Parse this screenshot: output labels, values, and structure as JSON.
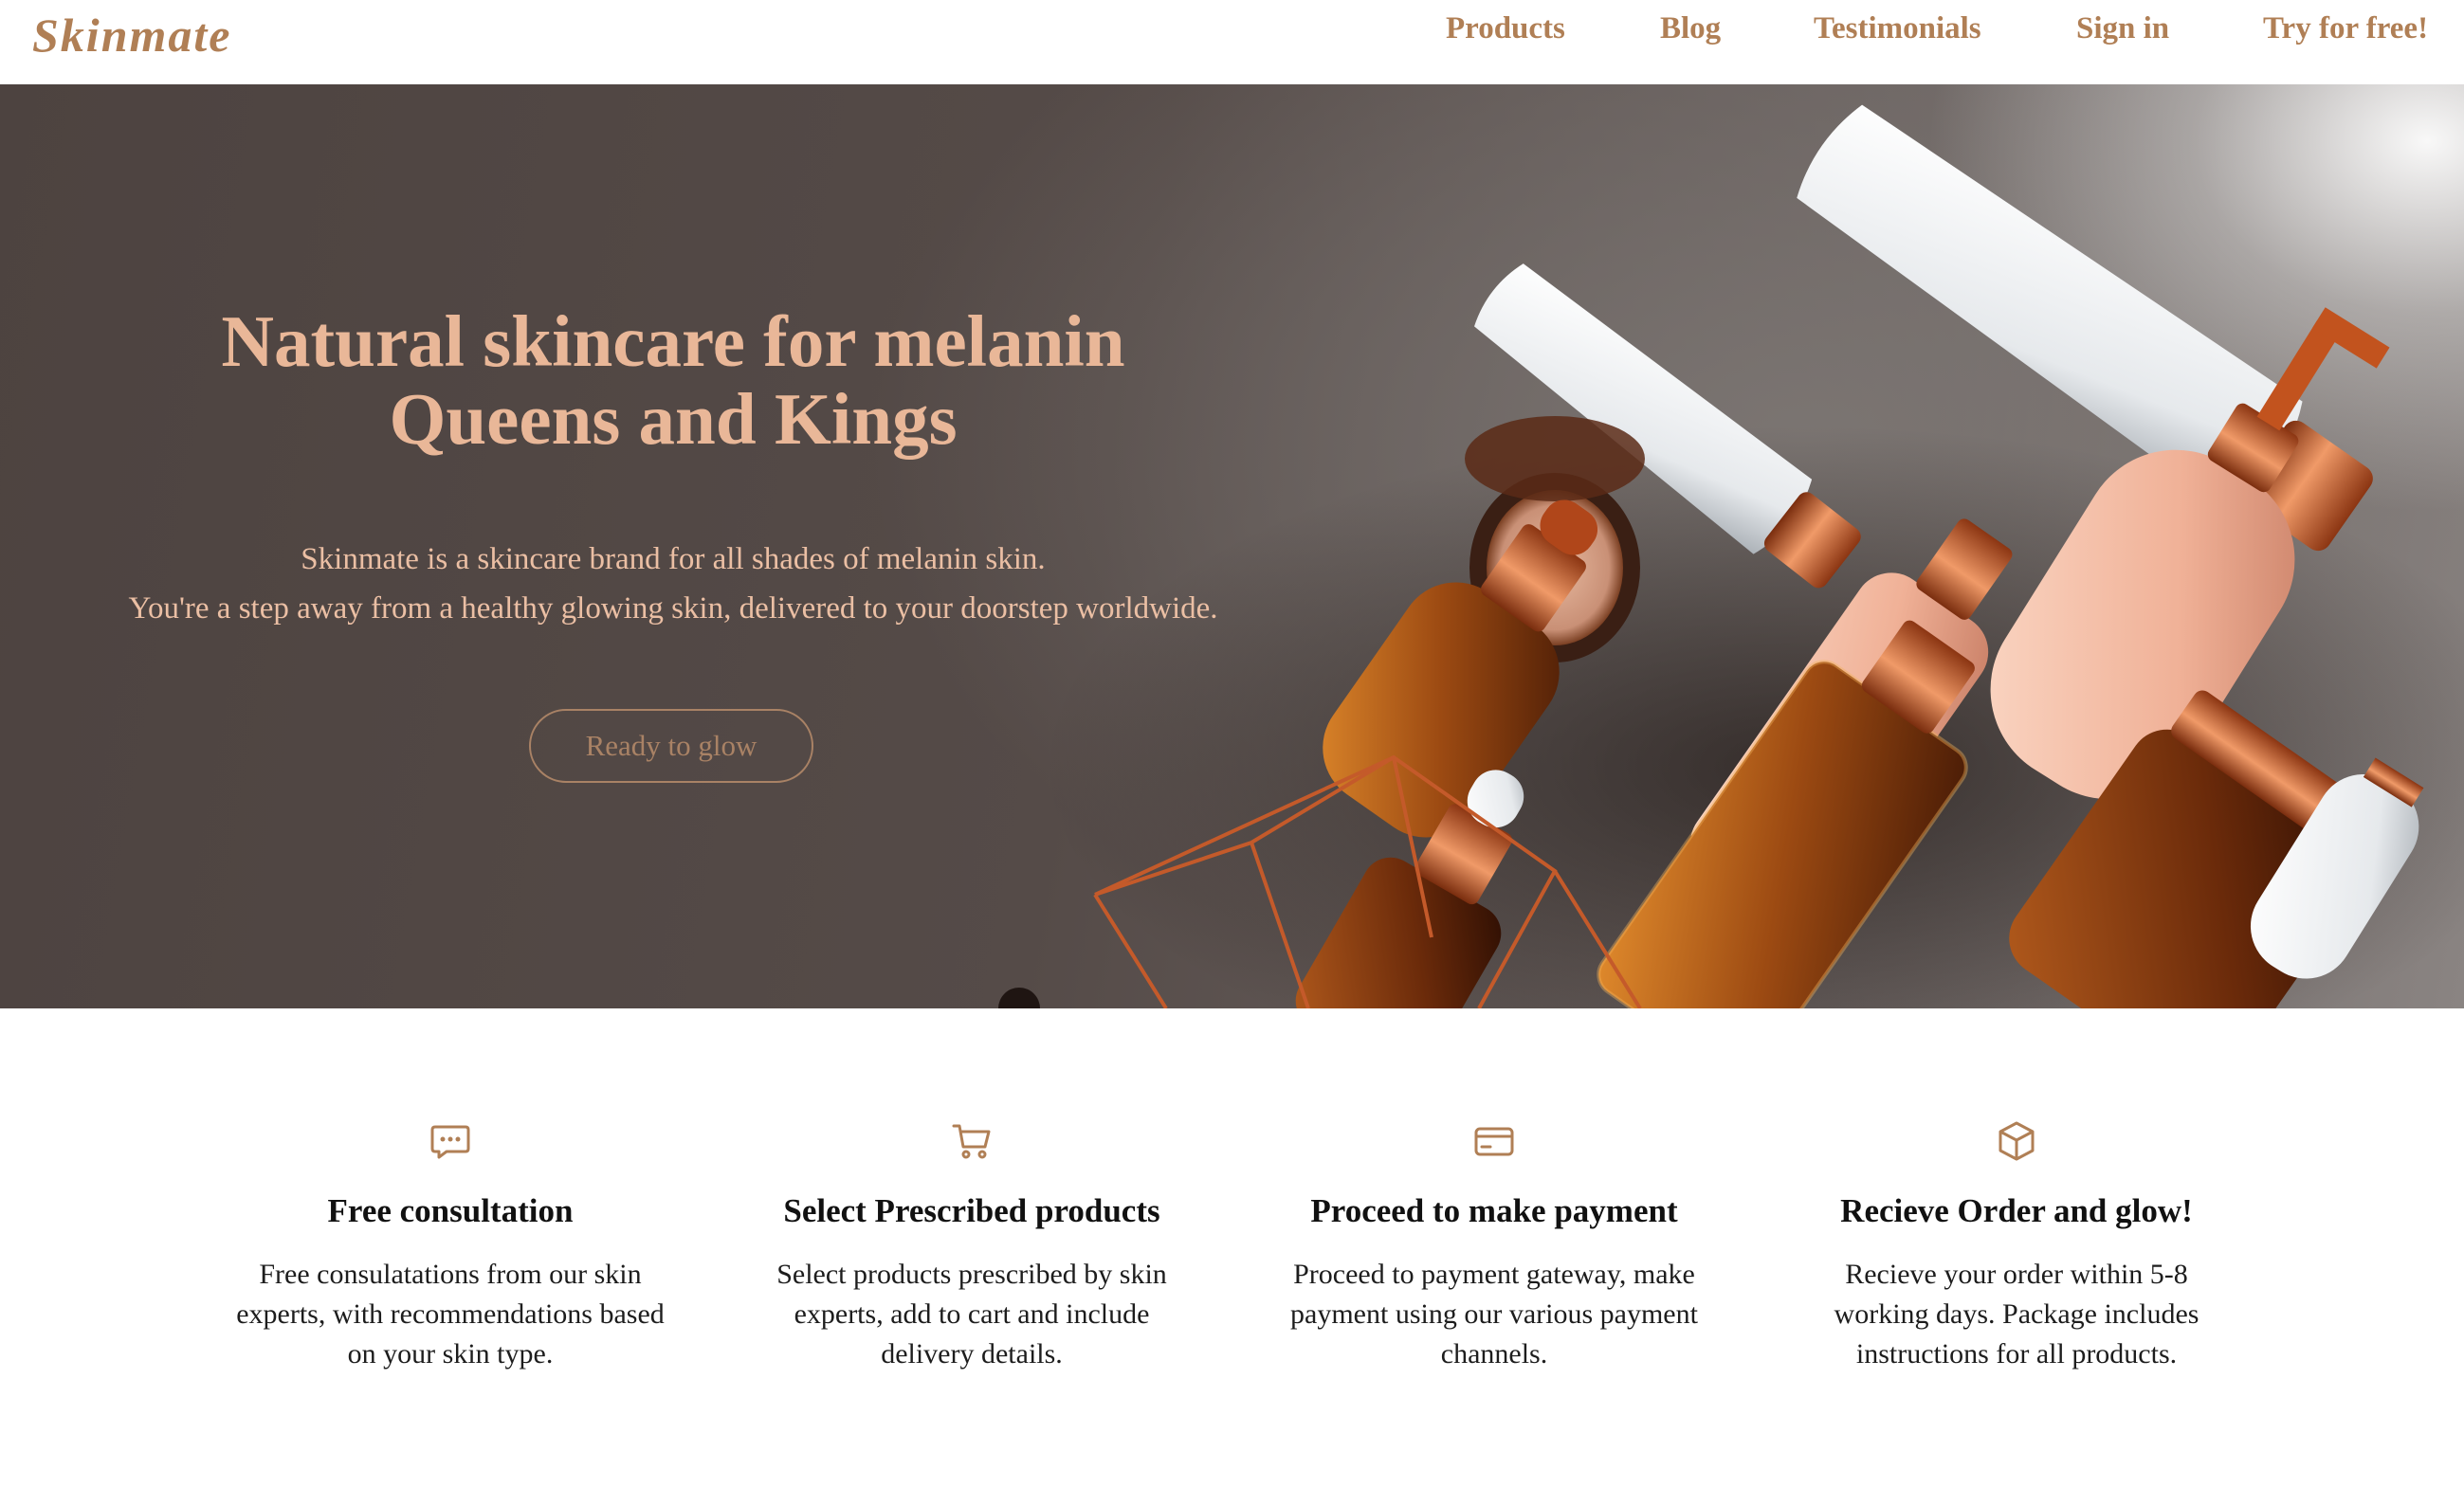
{
  "brand": {
    "name": "Skinmate",
    "color": "#b07f55"
  },
  "nav": {
    "products": "Products",
    "blog": "Blog",
    "testimonials": "Testimonials",
    "sign_in": "Sign in",
    "try_free": "Try for free!"
  },
  "hero": {
    "title_line1": "Natural skincare for melanin",
    "title_line2": "Queens and Kings",
    "subtitle_line1": "Skinmate is a skincare brand for all shades of melanin skin.",
    "subtitle_line2": "You're a step away from a healthy glowing skin, delivered to your doorstep worldwide.",
    "cta_label": "Ready to glow",
    "title_color": "#e9b798",
    "image_icon": "skincare-products-photo"
  },
  "steps": [
    {
      "icon": "chat-bubble-icon",
      "title": "Free consultation",
      "description": "Free consulatations from our skin experts, with recommendations based on your skin type."
    },
    {
      "icon": "shopping-cart-icon",
      "title": "Select Prescribed products",
      "description": "Select products prescribed by skin experts, add to cart and include delivery details."
    },
    {
      "icon": "credit-card-icon",
      "title": "Proceed to make payment",
      "description": "Proceed to payment gateway, make payment using our various payment channels."
    },
    {
      "icon": "package-box-icon",
      "title": "Recieve Order and glow!",
      "description": "Recieve your order within 5-8 working days. Package includes instructions for all products."
    }
  ]
}
